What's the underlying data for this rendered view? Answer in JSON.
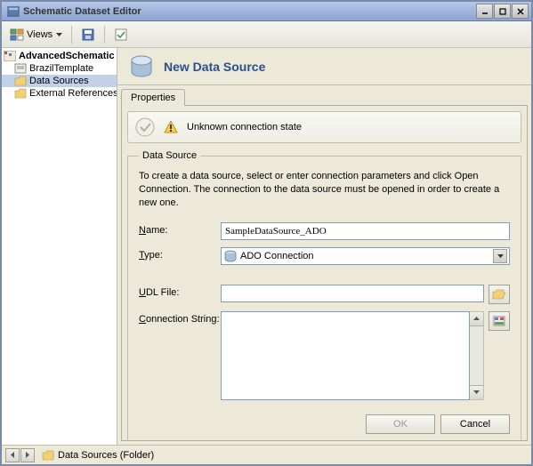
{
  "window": {
    "title": "Schematic Dataset Editor"
  },
  "toolbar": {
    "views_label": "Views"
  },
  "tree": {
    "root": "AdvancedSchematic",
    "items": [
      "BrazilTemplate",
      "Data Sources",
      "External References"
    ]
  },
  "header": {
    "title": "New Data Source"
  },
  "tabs": {
    "properties": "Properties"
  },
  "status": {
    "message": "Unknown connection state"
  },
  "fieldset": {
    "legend": "Data Source",
    "description": "To create a data source, select or enter connection parameters and click Open Connection.  The connection to the data source must be opened in order to create a new one."
  },
  "form": {
    "name_label": "Name:",
    "name_value": "SampleDataSource_ADO",
    "type_label": "Type:",
    "type_value": "ADO Connection",
    "udl_label": "UDL File:",
    "udl_value": "",
    "conn_label": "Connection String:",
    "conn_value": ""
  },
  "buttons": {
    "ok": "OK",
    "cancel": "Cancel"
  },
  "statusbar": {
    "text": "Data Sources (Folder)"
  }
}
